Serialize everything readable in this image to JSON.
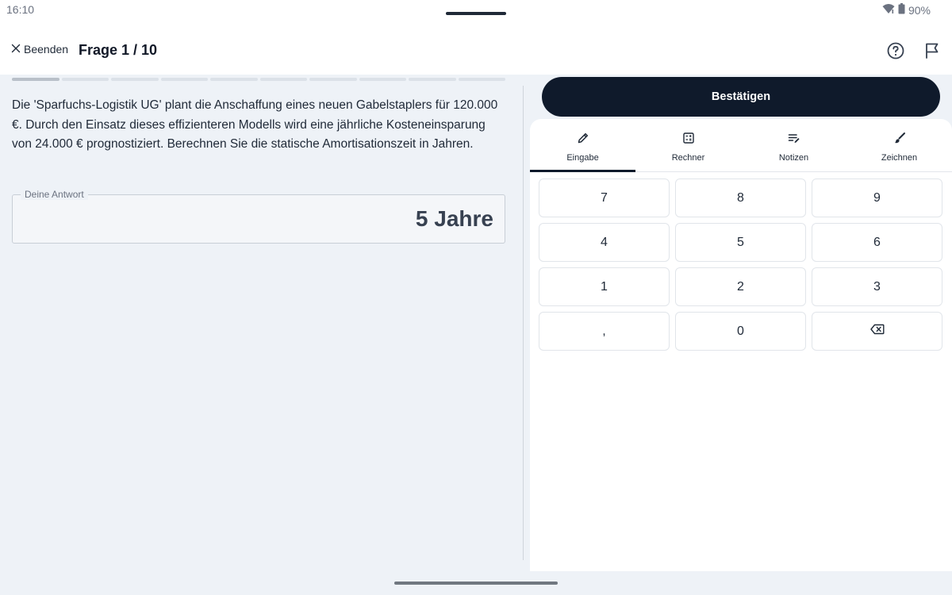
{
  "status": {
    "time": "16:10",
    "battery": "90%",
    "icons": [
      "wifi-icon",
      "battery-icon"
    ]
  },
  "header": {
    "quit_label": "Beenden",
    "title": "Frage 1 / 10",
    "icons": [
      "close-icon",
      "help-icon",
      "flag-icon"
    ]
  },
  "progress": {
    "current": 1,
    "total": 10
  },
  "question": {
    "text": "Die 'Sparfuchs-Logistik UG' plant die Anschaffung eines neuen Gabelstaplers für 120.000 €. Durch den Einsatz dieses effizienteren Modells wird eine jährliche Kosteneinsparung von 24.000 € prognostiziert. Berechnen Sie die statische Amortisationszeit in Jahren."
  },
  "answer": {
    "label": "Deine Antwort",
    "value": "5 Jahre"
  },
  "confirm_label": "Bestätigen",
  "tabs": [
    {
      "label": "Eingabe",
      "icon": "pencil-icon",
      "active": true
    },
    {
      "label": "Rechner",
      "icon": "calculator-icon",
      "active": false
    },
    {
      "label": "Notizen",
      "icon": "notes-icon",
      "active": false
    },
    {
      "label": "Zeichnen",
      "icon": "brush-icon",
      "active": false
    }
  ],
  "keypad": {
    "keys": [
      "7",
      "8",
      "9",
      "4",
      "5",
      "6",
      "1",
      "2",
      "3",
      ",",
      "0",
      ""
    ],
    "backspace_icon": "backspace-icon"
  },
  "colors": {
    "primary": "#0f1a2b",
    "background": "#eef2f7",
    "panel": "#ffffff"
  }
}
